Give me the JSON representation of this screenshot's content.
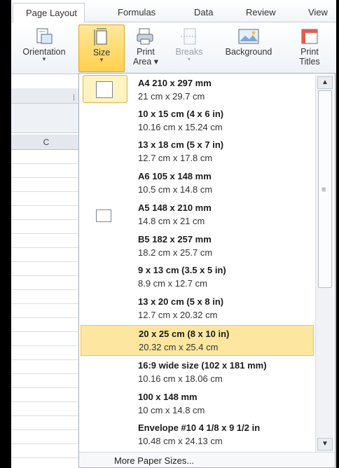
{
  "tabs": [
    "Page Layout",
    "Formulas",
    "Data",
    "Review",
    "View"
  ],
  "ribbon": {
    "orientation": "Orientation",
    "size": "Size",
    "print_area_1": "Print",
    "print_area_2": "Area",
    "breaks": "Breaks",
    "background": "Background",
    "print_titles_1": "Print",
    "print_titles_2": "Titles"
  },
  "sheet": {
    "column_c": "C"
  },
  "sizes": [
    {
      "name": "A4 210 x 297 mm",
      "dims": "21 cm x 29.7 cm"
    },
    {
      "name": "10 x 15 cm (4 x 6 in)",
      "dims": "10.16 cm x 15.24 cm"
    },
    {
      "name": "13 x 18 cm (5 x 7 in)",
      "dims": "12.7 cm x 17.8 cm"
    },
    {
      "name": "A6 105 x 148 mm",
      "dims": "10.5 cm x 14.8 cm"
    },
    {
      "name": "A5 148 x 210 mm",
      "dims": "14.8 cm x 21 cm"
    },
    {
      "name": "B5 182 x 257 mm",
      "dims": "18.2 cm x 25.7 cm"
    },
    {
      "name": "9 x 13 cm (3.5 x 5 in)",
      "dims": "8.9 cm x 12.7 cm"
    },
    {
      "name": "13 x 20 cm (5 x 8 in)",
      "dims": "12.7 cm x 20.32 cm"
    },
    {
      "name": "20 x 25 cm (8 x 10 in)",
      "dims": "20.32 cm x 25.4 cm"
    },
    {
      "name": "16:9 wide size (102 x 181 mm)",
      "dims": "10.16 cm x 18.06 cm"
    },
    {
      "name": "100 x 148 mm",
      "dims": "10 cm x 14.8 cm"
    },
    {
      "name": "Envelope #10 4 1/8 x 9 1/2 in",
      "dims": "10.48 cm x 24.13 cm"
    }
  ],
  "more_sizes": "More Paper Sizes...",
  "colors": {
    "highlight": "#fde7a0",
    "highlight_border": "#f0c24b"
  }
}
